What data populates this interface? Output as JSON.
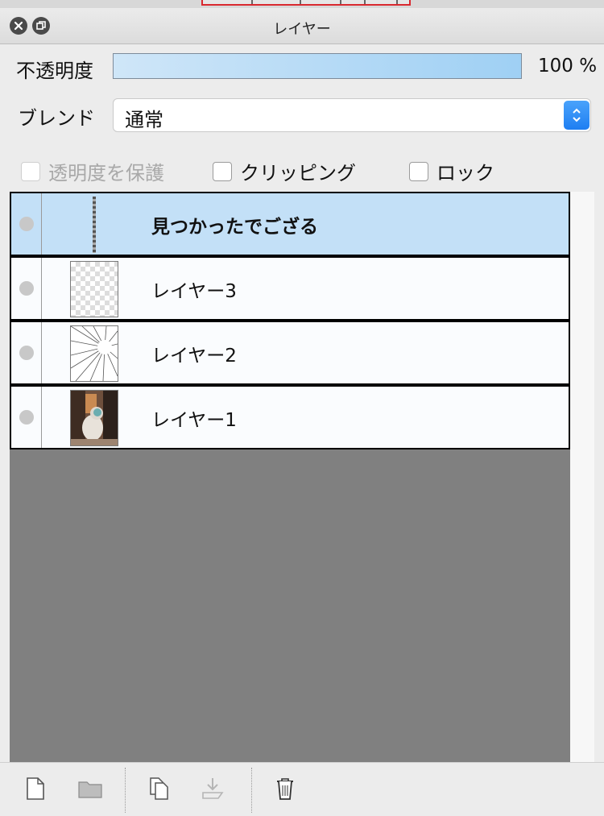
{
  "window": {
    "title": "レイヤー",
    "close_icon": "close-icon",
    "restore_icon": "restore-icon"
  },
  "opacity": {
    "label": "不透明度",
    "value": "100 %",
    "fill_percent": 100
  },
  "blend": {
    "label": "ブレンド",
    "value": "通常"
  },
  "checkboxes": {
    "protect_transparency": {
      "label": "透明度を保護",
      "checked": false,
      "enabled": false
    },
    "clipping": {
      "label": "クリッピング",
      "checked": false,
      "enabled": true
    },
    "lock": {
      "label": "ロック",
      "checked": false,
      "enabled": true
    }
  },
  "layers": [
    {
      "name": "見つかったでござる",
      "selected": true,
      "thumb": "thin-strip"
    },
    {
      "name": "レイヤー3",
      "selected": false,
      "thumb": "transparent"
    },
    {
      "name": "レイヤー2",
      "selected": false,
      "thumb": "radial-lines"
    },
    {
      "name": "レイヤー1",
      "selected": false,
      "thumb": "cat-photo"
    }
  ],
  "toolbar": {
    "icons": [
      "new-layer-icon",
      "new-folder-icon",
      "duplicate-layer-icon",
      "merge-down-icon",
      "trash-icon"
    ]
  },
  "colors": {
    "selected_row": "#c3e0f7",
    "opacity_fill": "#9fd0f4",
    "accent_blue": "#1e7ef2"
  }
}
